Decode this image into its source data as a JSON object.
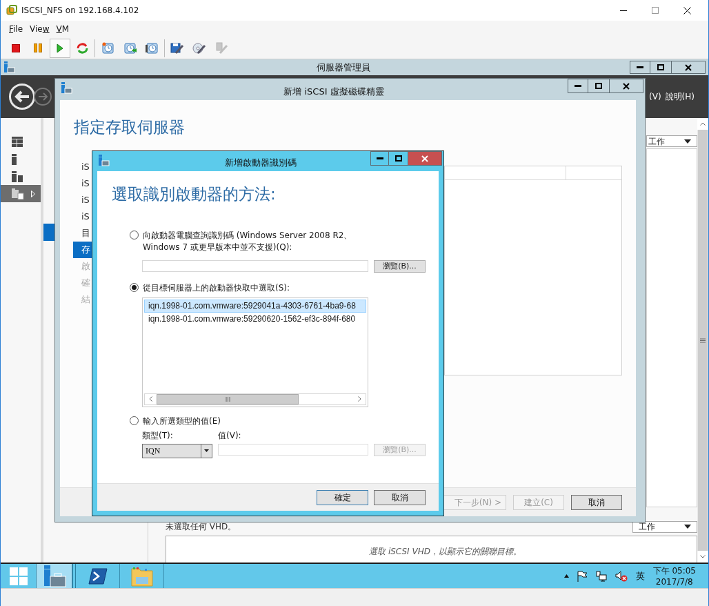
{
  "vm_window": {
    "title": "ISCSI_NFS on 192.168.4.102",
    "menu": [
      {
        "parts": [
          {
            "text": "F",
            "underline": true
          },
          {
            "text": "ile",
            "underline": false
          }
        ]
      },
      {
        "parts": [
          {
            "text": "Vie",
            "underline": false
          },
          {
            "text": "w",
            "underline": true
          }
        ]
      },
      {
        "parts": [
          {
            "text": "V",
            "underline": true
          },
          {
            "text": "M",
            "underline": false
          }
        ]
      }
    ],
    "toolbar": [
      {
        "kind": "stop",
        "pressed": false,
        "disabled": false
      },
      {
        "kind": "pause",
        "pressed": false,
        "disabled": false
      },
      {
        "kind": "play",
        "pressed": true,
        "disabled": false
      },
      {
        "kind": "reset",
        "pressed": false,
        "disabled": false
      },
      {
        "kind": "snapshot-take",
        "pressed": false,
        "disabled": false
      },
      {
        "kind": "snapshot-revert",
        "pressed": false,
        "disabled": false
      },
      {
        "kind": "snapshot-manage",
        "pressed": false,
        "disabled": false
      },
      {
        "kind": "settings",
        "pressed": false,
        "disabled": false
      },
      {
        "kind": "cd",
        "pressed": false,
        "disabled": false
      },
      {
        "kind": "usb",
        "pressed": false,
        "disabled": true
      }
    ]
  },
  "server_manager": {
    "title": "伺服器管理員",
    "menus": [
      "(V)",
      "說明(H)"
    ],
    "nav": [
      {
        "kind": "dashboard",
        "selected": false,
        "expandable": false
      },
      {
        "kind": "local-server",
        "selected": false,
        "expandable": false
      },
      {
        "kind": "all-servers",
        "selected": false,
        "expandable": false
      },
      {
        "kind": "file-services",
        "selected": true,
        "expandable": true
      }
    ],
    "tasks_menus": [
      "工作",
      "工作"
    ],
    "vhd_status": "未選取任何 VHD。",
    "targets_hint": "選取 iSCSI VHD，以顯示它的關聯目標。"
  },
  "wizard": {
    "title": "新增 iSCSI 虛擬磁碟精靈",
    "heading": "指定存取伺服器",
    "steps": [
      {
        "label": "iS",
        "selected": false,
        "disabled": false
      },
      {
        "label": "iS",
        "selected": false,
        "disabled": false
      },
      {
        "label": "iS",
        "selected": false,
        "disabled": false
      },
      {
        "label": "iS",
        "selected": false,
        "disabled": false
      },
      {
        "label": "目",
        "selected": false,
        "disabled": false
      },
      {
        "label": "存",
        "selected": true,
        "disabled": false
      },
      {
        "label": "啟",
        "selected": false,
        "disabled": true
      },
      {
        "label": "確",
        "selected": false,
        "disabled": true
      },
      {
        "label": "結",
        "selected": false,
        "disabled": true
      }
    ],
    "buttons": [
      {
        "label": "下一步(N) >",
        "disabled": true
      },
      {
        "label": "建立(C)",
        "disabled": true
      },
      {
        "label": "取消",
        "disabled": false
      }
    ]
  },
  "dialog": {
    "title": "新增啟動器識別碼",
    "heading": "選取識別啟動器的方法:",
    "options": [
      {
        "label": "向啟動器電腦查詢識別碼 (Windows Server 2008 R2、 Windows 7 或更早版本中並不支援)(Q):",
        "selected": false
      },
      {
        "label": "從目標伺服器上的啟動器快取中選取(S):",
        "selected": true
      },
      {
        "label": "輸入所選類型的值(E)",
        "selected": false
      }
    ],
    "browse_buttons": [
      {
        "label": "瀏覽(B)...",
        "disabled": false
      },
      {
        "label": "瀏覽(B)...",
        "disabled": true
      }
    ],
    "initiators": [
      {
        "label": "iqn.1998-01.com.vmware:5929041a-4303-6761-4ba9-68",
        "selected": true
      },
      {
        "label": "iqn.1998-01.com.vmware:59290620-1562-ef3c-894f-680",
        "selected": false
      }
    ],
    "type_label": "類型(T):",
    "type_value": "IQN",
    "value_label": "值(V):",
    "buttons": [
      {
        "label": "確定",
        "default": true
      },
      {
        "label": "取消",
        "default": false
      }
    ]
  },
  "taskbar": {
    "apps": [
      {
        "kind": "start",
        "active": false
      },
      {
        "kind": "server-manager",
        "active": true
      },
      {
        "kind": "powershell",
        "active": false
      },
      {
        "kind": "file-explorer",
        "active": false
      }
    ],
    "input_language": "英",
    "time": "下午 05:05",
    "date": "2017/7/8"
  }
}
